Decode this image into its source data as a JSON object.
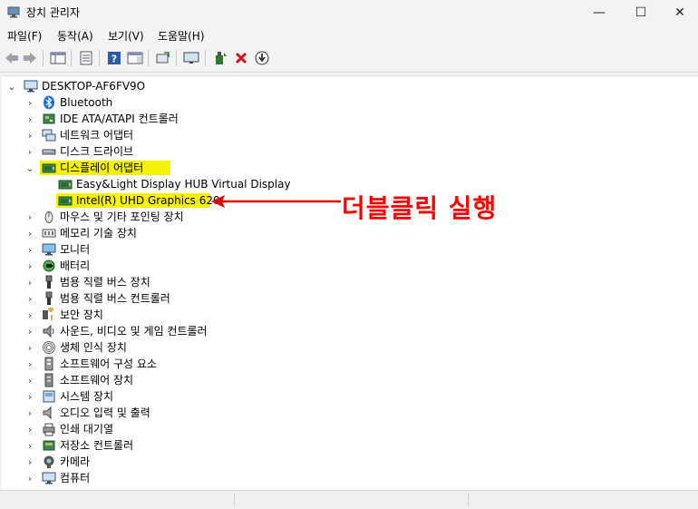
{
  "window": {
    "title": "장치 관리자",
    "minimize": "—",
    "maximize": "☐",
    "close": "✕"
  },
  "menu": [
    "파일(F)",
    "동작(A)",
    "보기(V)",
    "도움말(H)"
  ],
  "toolbar": {
    "back": "back-arrow-icon",
    "forward": "forward-arrow-icon"
  },
  "tree": {
    "root": "DESKTOP-AF6FV9O",
    "categories": [
      {
        "label": "Bluetooth",
        "icon": "bluetooth-icon"
      },
      {
        "label": "IDE ATA/ATAPI 컨트롤러",
        "icon": "ide-controller-icon"
      },
      {
        "label": "네트워크 어댑터",
        "icon": "network-adapter-icon"
      },
      {
        "label": "디스크 드라이브",
        "icon": "disk-drive-icon"
      },
      {
        "label": "디스플레이 어댑터",
        "icon": "display-adapter-icon",
        "expanded": true,
        "children": [
          {
            "label": "Easy&Light Display HUB Virtual Display",
            "icon": "display-adapter-icon"
          },
          {
            "label": "Intel(R) UHD Graphics 620",
            "icon": "display-adapter-icon",
            "highlighted": true
          }
        ]
      },
      {
        "label": "마우스 및 기타 포인팅 장치",
        "icon": "mouse-icon"
      },
      {
        "label": "메모리 기술 장치",
        "icon": "memory-device-icon"
      },
      {
        "label": "모니터",
        "icon": "monitor-icon"
      },
      {
        "label": "배터리",
        "icon": "battery-icon"
      },
      {
        "label": "범용 직렬 버스 장치",
        "icon": "usb-device-icon"
      },
      {
        "label": "범용 직렬 버스 컨트롤러",
        "icon": "usb-controller-icon"
      },
      {
        "label": "보안 장치",
        "icon": "security-device-icon"
      },
      {
        "label": "사운드, 비디오 및 게임 컨트롤러",
        "icon": "sound-icon"
      },
      {
        "label": "생체 인식 장치",
        "icon": "biometric-icon"
      },
      {
        "label": "소프트웨어 구성 요소",
        "icon": "software-component-icon"
      },
      {
        "label": "소프트웨어 장치",
        "icon": "software-device-icon"
      },
      {
        "label": "시스템 장치",
        "icon": "system-device-icon"
      },
      {
        "label": "오디오 입력 및 출력",
        "icon": "audio-io-icon"
      },
      {
        "label": "인쇄 대기열",
        "icon": "printer-icon"
      },
      {
        "label": "저장소 컨트롤러",
        "icon": "storage-controller-icon"
      },
      {
        "label": "카메라",
        "icon": "camera-icon"
      },
      {
        "label": "컴퓨터",
        "icon": "computer-icon"
      }
    ]
  },
  "annotation": "더블클릭 실행",
  "colors": {
    "highlight": "#f6f300",
    "annotation": "#ff0000",
    "arrow": "#e00000"
  }
}
